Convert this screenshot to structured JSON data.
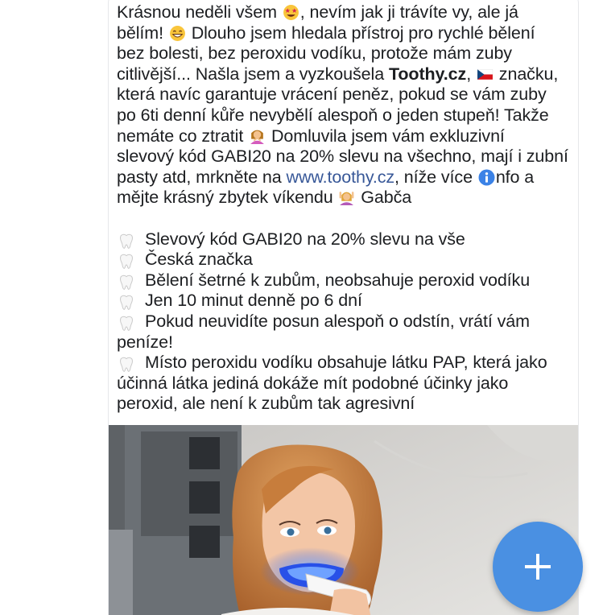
{
  "post": {
    "intro": {
      "l1a": "Krásnou neděli všem ",
      "l1b": ", nevím jak ji trávíte vy, ale já",
      "l2a": "bělím! ",
      "l2b": " Dlouho jsem hledala přístroj pro rychlé bělení",
      "l3": "bez bolesti, bez peroxidu vodíku, protože mám zuby",
      "l4a": "citlivější... Našla jsem a vyzkoušela ",
      "l4b": "Toothy.cz",
      "l4c": ", ",
      "l4d": " značku,",
      "l5": "která navíc garantuje vrácení peněz, pokud se vám zuby",
      "l6": "po 6ti denní kůře nevybělí alespoň o jeden stupeň! Takže",
      "l7a": "nemáte co ztratit ",
      "l7b": " Domluvila jsem vám exkluzivní",
      "l8": "slevový kód GABI20 na 20% slevu na všechno, mají i zubní",
      "l9a": "pasty atd, mrkněte na ",
      "l9b": "www.toothy.cz",
      "l9c": ", níže více ",
      "l9d": "nfo a",
      "l10a": "mějte krásný zbytek víkendu ",
      "l10b": " Gabča"
    },
    "bullets": [
      {
        "lines": [
          "Slevový kód GABI20 na 20% slevu na vše"
        ]
      },
      {
        "lines": [
          "Česká značka"
        ]
      },
      {
        "lines": [
          "Bělení šetrné k zubům, neobsahuje peroxid vodíku"
        ]
      },
      {
        "lines": [
          "Jen 10 minut denně po 6 dní"
        ]
      },
      {
        "lines": [
          "Pokud neuvidíte posun alespoň o odstín, vrátí vám",
          "peníze!"
        ]
      },
      {
        "lines": [
          "Místo peroxidu vodíku obsahuje látku PAP, která jako",
          "účinná látka jediná dokáže mít podobné účinky jako",
          "peroxid, ale není k zubům tak agresivní"
        ]
      }
    ]
  },
  "icons": {
    "star_struck": "star-struck-emoji",
    "grin": "grinning-emoji",
    "czech_flag": "czech-flag-emoji",
    "woman_gesturing": "woman-gesturing-emoji",
    "info": "information-icon",
    "woman_raising_hands": "woman-raising-hands-emoji",
    "tooth": "tooth-emoji",
    "add": "plus-icon"
  },
  "colors": {
    "text": "#1c1e21",
    "link": "#385898",
    "fab": "#4a90e2"
  }
}
